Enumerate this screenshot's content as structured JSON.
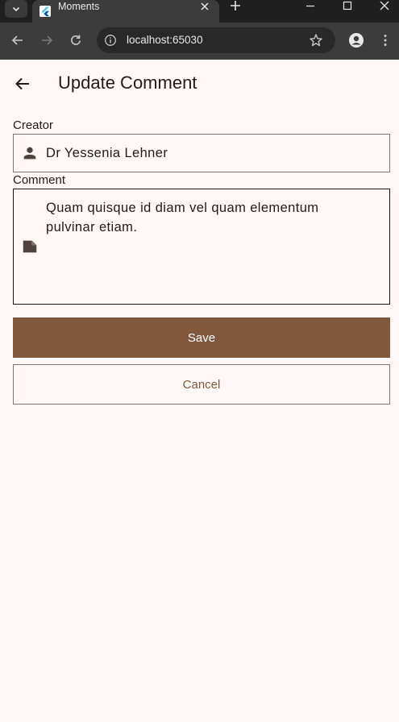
{
  "browser": {
    "tab_title": "Moments",
    "url": "localhost:65030"
  },
  "app": {
    "title": "Update Comment",
    "creator": {
      "label": "Creator",
      "value": "Dr Yessenia Lehner",
      "icon": "person-icon"
    },
    "comment": {
      "label": "Comment",
      "value": "Quam quisque id diam vel quam elementum pulvinar etiam.",
      "icon": "note-icon"
    },
    "save_label": "Save",
    "cancel_label": "Cancel"
  },
  "colors": {
    "background": "#fff8f6",
    "primary": "#82583d",
    "outline": "#857370",
    "text": "#231918"
  }
}
